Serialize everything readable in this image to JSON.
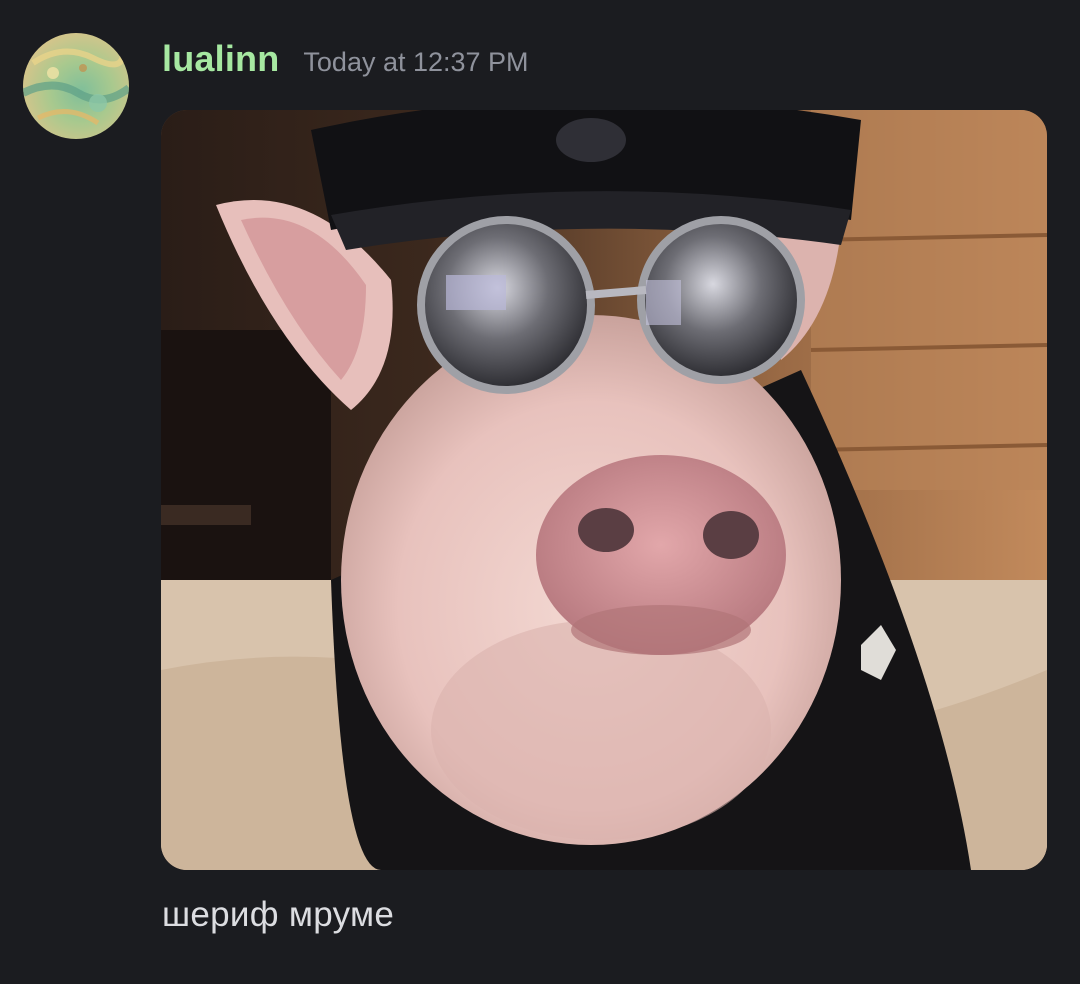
{
  "message": {
    "author": "lualinn",
    "timestamp": "Today at 12:37 PM",
    "text": "шериф мруме",
    "avatar_icon": "avatar-image",
    "attachment_icon": "pig-with-sunglasses-and-police-cap-image"
  },
  "colors": {
    "background": "#1b1c20",
    "username": "#a6e8a1",
    "timestamp": "#8f929c",
    "text": "#dcdde1"
  }
}
